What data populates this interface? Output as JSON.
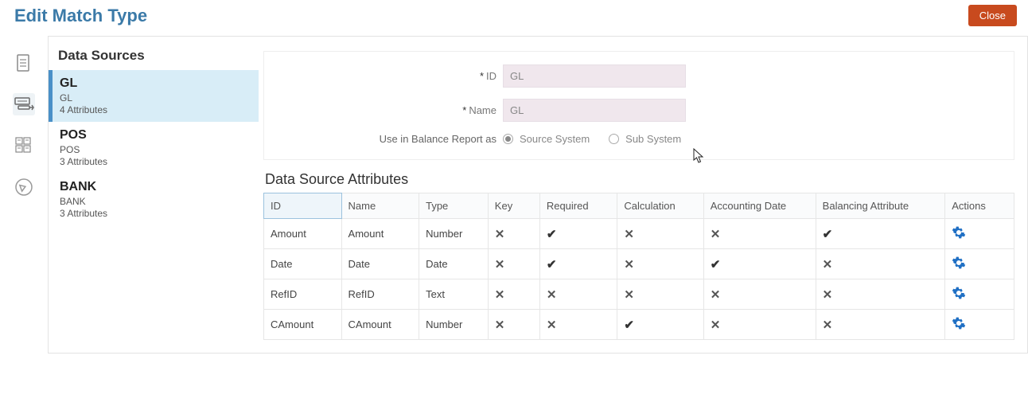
{
  "header": {
    "title": "Edit Match Type",
    "closeLabel": "Close"
  },
  "sidebarTitle": "Data Sources",
  "dataSources": [
    {
      "name": "GL",
      "sub": "GL",
      "count": "4 Attributes",
      "selected": true
    },
    {
      "name": "POS",
      "sub": "POS",
      "count": "3 Attributes",
      "selected": false
    },
    {
      "name": "BANK",
      "sub": "BANK",
      "count": "3 Attributes",
      "selected": false
    }
  ],
  "form": {
    "idLabel": "ID",
    "idValue": "GL",
    "nameLabel": "Name",
    "nameValue": "GL",
    "balanceReportLabel": "Use in Balance Report as",
    "optSource": "Source System",
    "optSub": "Sub System"
  },
  "attrTitle": "Data Source Attributes",
  "columns": {
    "id": "ID",
    "name": "Name",
    "type": "Type",
    "key": "Key",
    "required": "Required",
    "calculation": "Calculation",
    "accountingDate": "Accounting Date",
    "balancingAttribute": "Balancing Attribute",
    "actions": "Actions"
  },
  "rows": [
    {
      "id": "Amount",
      "name": "Amount",
      "type": "Number",
      "key": "x",
      "required": "check",
      "calculation": "x",
      "accountingDate": "x",
      "balancingAttribute": "check"
    },
    {
      "id": "Date",
      "name": "Date",
      "type": "Date",
      "key": "x",
      "required": "check",
      "calculation": "x",
      "accountingDate": "check",
      "balancingAttribute": "x"
    },
    {
      "id": "RefID",
      "name": "RefID",
      "type": "Text",
      "key": "x",
      "required": "x",
      "calculation": "x",
      "accountingDate": "x",
      "balancingAttribute": "x"
    },
    {
      "id": "CAmount",
      "name": "CAmount",
      "type": "Number",
      "key": "x",
      "required": "x",
      "calculation": "check",
      "accountingDate": "x",
      "balancingAttribute": "x"
    }
  ]
}
